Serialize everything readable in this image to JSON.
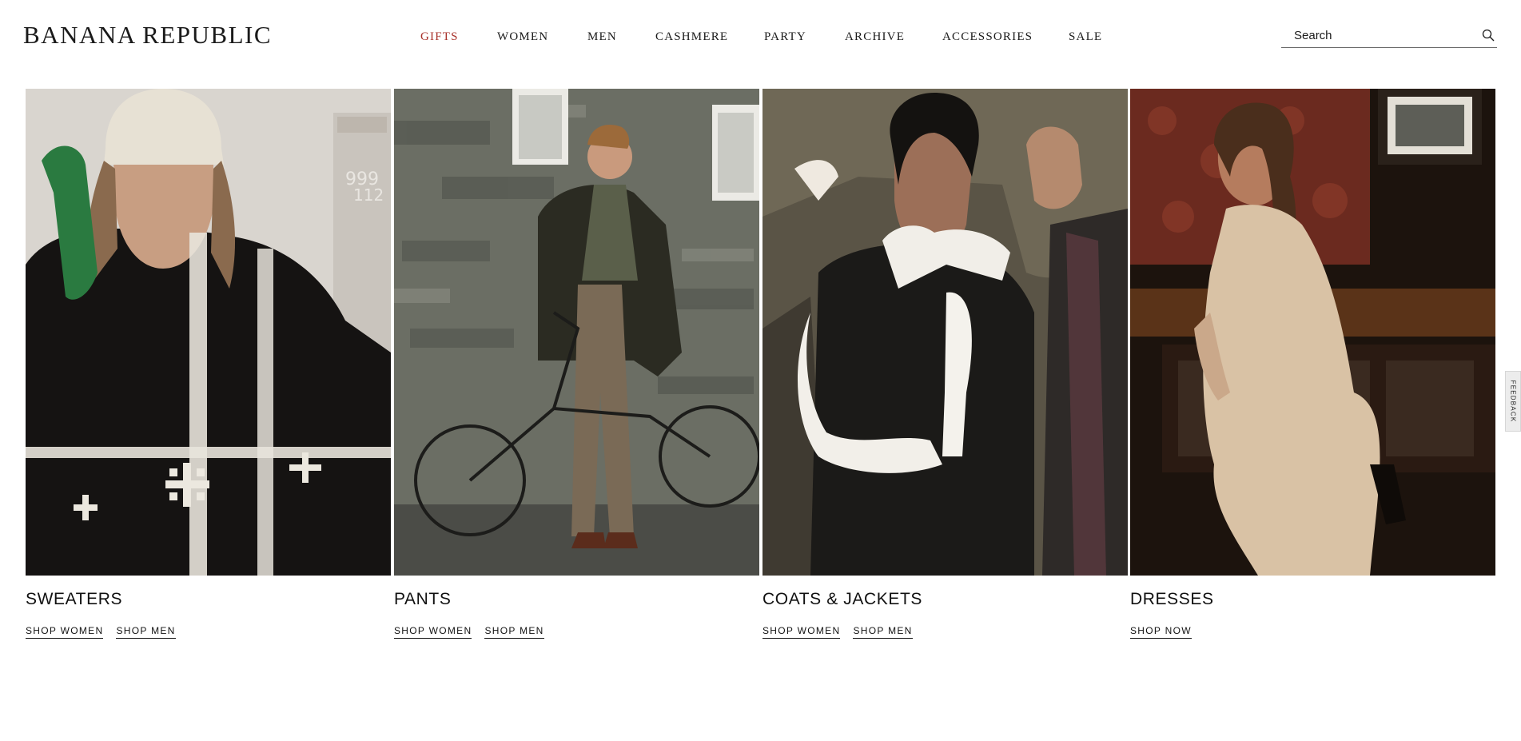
{
  "brand": {
    "logo_text": "BANANA REPUBLIC"
  },
  "nav": {
    "items": [
      {
        "label": "GIFTS",
        "accent": true
      },
      {
        "label": "WOMEN"
      },
      {
        "label": "MEN"
      },
      {
        "label": "CASHMERE"
      },
      {
        "label": "PARTY"
      },
      {
        "label": "ARCHIVE"
      },
      {
        "label": "ACCESSORIES"
      },
      {
        "label": "SALE"
      }
    ]
  },
  "search": {
    "placeholder": "Search",
    "value": "",
    "icon": "magnifier-icon"
  },
  "colors": {
    "accent": "#a8322b",
    "text": "#111111",
    "background": "#ffffff"
  },
  "tiles": [
    {
      "title": "SWEATERS",
      "image": "woman-in-snowflake-sweater-with-phone",
      "links": [
        "SHOP WOMEN",
        "SHOP MEN"
      ]
    },
    {
      "title": "PANTS",
      "image": "man-with-bicycle-by-stone-wall",
      "links": [
        "SHOP WOMEN",
        "SHOP MEN"
      ]
    },
    {
      "title": "COATS & JACKETS",
      "image": "woman-in-shearling-jacket",
      "links": [
        "SHOP WOMEN",
        "SHOP MEN"
      ]
    },
    {
      "title": "DRESSES",
      "image": "woman-in-knit-dress-seated",
      "links": [
        "SHOP NOW"
      ]
    }
  ],
  "feedback": {
    "label": "FEEDBACK"
  }
}
